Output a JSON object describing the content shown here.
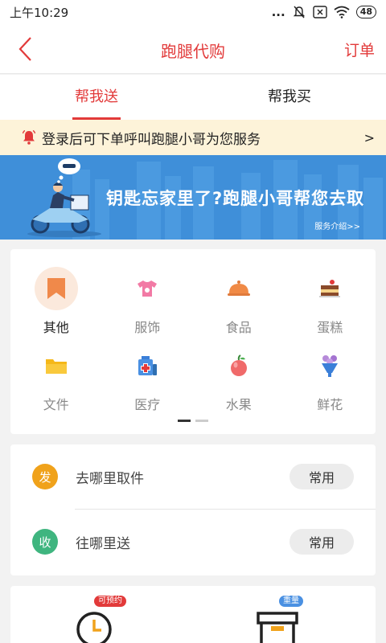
{
  "status_bar": {
    "time": "上午10:29",
    "signal": "...",
    "battery": "48"
  },
  "nav": {
    "title": "跑腿代购",
    "right_link": "订单"
  },
  "tabs": [
    {
      "label": "帮我送",
      "active": true
    },
    {
      "label": "帮我买",
      "active": false
    }
  ],
  "notice": {
    "text": "登录后可下单呼叫跑腿小哥为您服务",
    "arrow": ">"
  },
  "banner": {
    "headline": "钥匙忘家里了?跑腿小哥帮您去取",
    "link": "服务介绍>>"
  },
  "categories": [
    {
      "label": "其他",
      "icon": "bookmark-icon",
      "active": true
    },
    {
      "label": "服饰",
      "icon": "tshirt-icon",
      "active": false
    },
    {
      "label": "食品",
      "icon": "food-cloche-icon",
      "active": false
    },
    {
      "label": "蛋糕",
      "icon": "cake-icon",
      "active": false
    },
    {
      "label": "文件",
      "icon": "folder-icon",
      "active": false
    },
    {
      "label": "医疗",
      "icon": "medicine-icon",
      "active": false
    },
    {
      "label": "水果",
      "icon": "apple-icon",
      "active": false
    },
    {
      "label": "鲜花",
      "icon": "flower-icon",
      "active": false
    }
  ],
  "pager": {
    "pages": 2,
    "current": 1
  },
  "address": {
    "pickup": {
      "badge": "发",
      "placeholder": "去哪里取件",
      "button": "常用",
      "color": "#f0a21b"
    },
    "dropoff": {
      "badge": "收",
      "placeholder": "往哪里送",
      "button": "常用",
      "color": "#3fb57f"
    }
  },
  "options": {
    "time": {
      "tag": "可预约",
      "icon": "clock-icon"
    },
    "weight": {
      "tag": "重量",
      "icon": "box-icon"
    }
  },
  "colors": {
    "brand": "#e23a3a",
    "banner": "#3f8fd9",
    "notice_bg": "#fdf3d9"
  }
}
